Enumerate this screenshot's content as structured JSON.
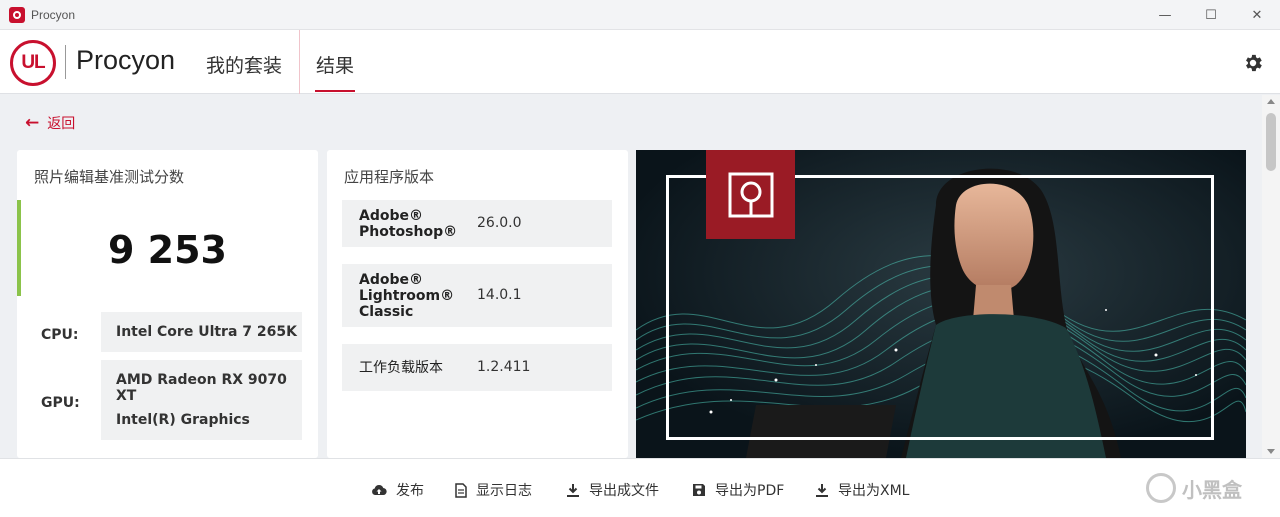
{
  "window": {
    "title": "Procyon"
  },
  "header": {
    "logo_text": "UL",
    "brand": "Procyon",
    "nav": {
      "suite": "我的套装",
      "results": "结果"
    }
  },
  "back": {
    "label": "返回"
  },
  "score_card": {
    "title": "照片编辑基准测试分数",
    "score": "9 253",
    "cpu_label": "CPU:",
    "cpu_value": "Intel Core Ultra 7 265K",
    "gpu_label": "GPU:",
    "gpu_values": [
      "AMD Radeon RX 9070 XT",
      "Intel(R) Graphics"
    ]
  },
  "version_card": {
    "title": "应用程序版本",
    "rows": [
      {
        "name_lines": [
          "Adobe®",
          "Photoshop®"
        ],
        "version": "26.0.0"
      },
      {
        "name_lines": [
          "Adobe®",
          "Lightroom®",
          "Classic"
        ],
        "version": "14.0.1"
      },
      {
        "name_lines": [
          "工作负载版本"
        ],
        "version": "1.2.411"
      }
    ]
  },
  "footer": {
    "publish": "发布",
    "show_log": "显示日志",
    "export_file": "导出成文件",
    "export_pdf": "导出为PDF",
    "export_xml": "导出为XML"
  },
  "watermark": {
    "text": "小黑盒"
  },
  "colors": {
    "accent": "#c8102e",
    "score_bar": "#8bc34a"
  }
}
